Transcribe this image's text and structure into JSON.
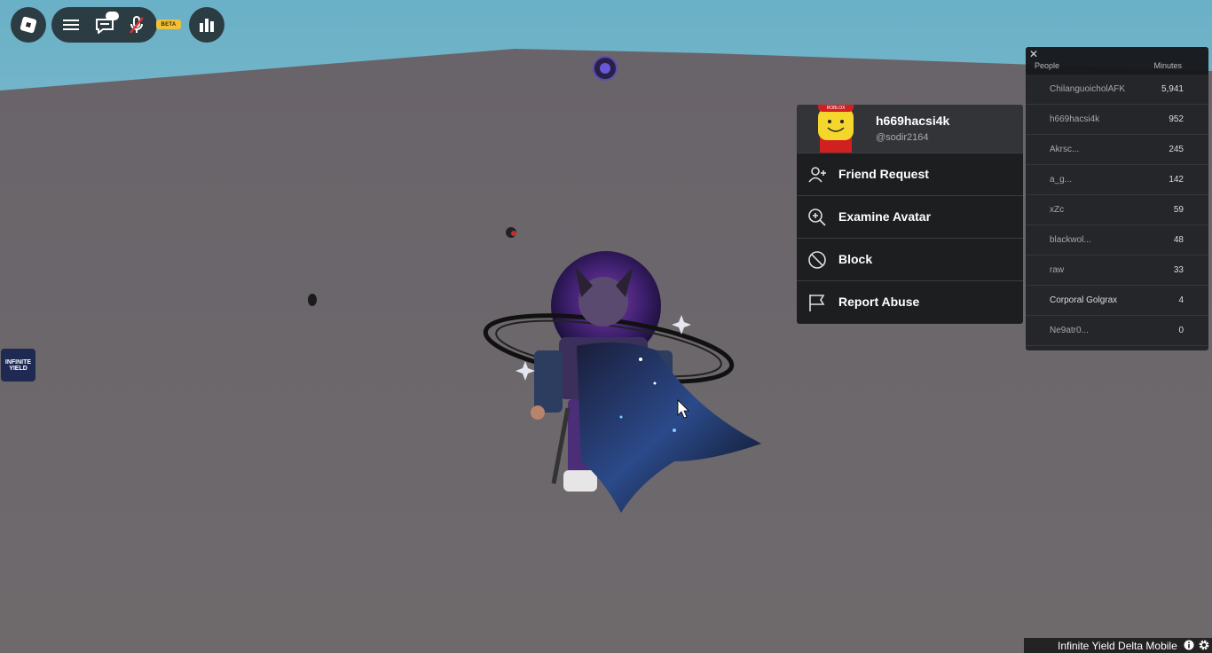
{
  "toolbar": {
    "roblox_menu_icon": "roblox-logo-icon",
    "hamburger_icon": "hamburger-menu-icon",
    "chat_icon": "chat-icon",
    "mic_icon": "microphone-muted-icon",
    "beta_label": "BETA",
    "leaderboard_icon": "leaderboard-icon"
  },
  "side_logo": {
    "text": "INFINITE YIELD"
  },
  "player_card": {
    "display_name": "h669hacsi4k",
    "username": "@sodir2164",
    "avatar_cap_text": "ROBLOX",
    "actions": [
      {
        "label": "Friend Request",
        "icon": "add-friend-icon"
      },
      {
        "label": "Examine Avatar",
        "icon": "zoom-in-icon"
      },
      {
        "label": "Block",
        "icon": "block-icon"
      },
      {
        "label": "Report Abuse",
        "icon": "flag-icon"
      }
    ]
  },
  "leaderboard": {
    "close_label": "✕",
    "col_people": "People",
    "col_minutes": "Minutes",
    "rows": [
      {
        "name": "ChilanguoicholAFK",
        "minutes": "5,941"
      },
      {
        "name": "h669hacsi4k",
        "minutes": "952"
      },
      {
        "name": "Akrsc...",
        "minutes": "245"
      },
      {
        "name": "a_g...",
        "minutes": "142"
      },
      {
        "name": "xZc",
        "minutes": "59"
      },
      {
        "name": "blackwol...",
        "minutes": "48"
      },
      {
        "name": "raw",
        "minutes": "33"
      },
      {
        "name": "Corporal Golgrax",
        "minutes": "4"
      },
      {
        "name": "Ne9atr0...",
        "minutes": "0"
      }
    ]
  },
  "status_bar": {
    "text": "Infinite Yield Delta Mobile"
  },
  "colors": {
    "sky": "#66a8c0",
    "ground": "#6b6669",
    "panel": "#18191b",
    "accent_beta": "#f0c03a"
  }
}
